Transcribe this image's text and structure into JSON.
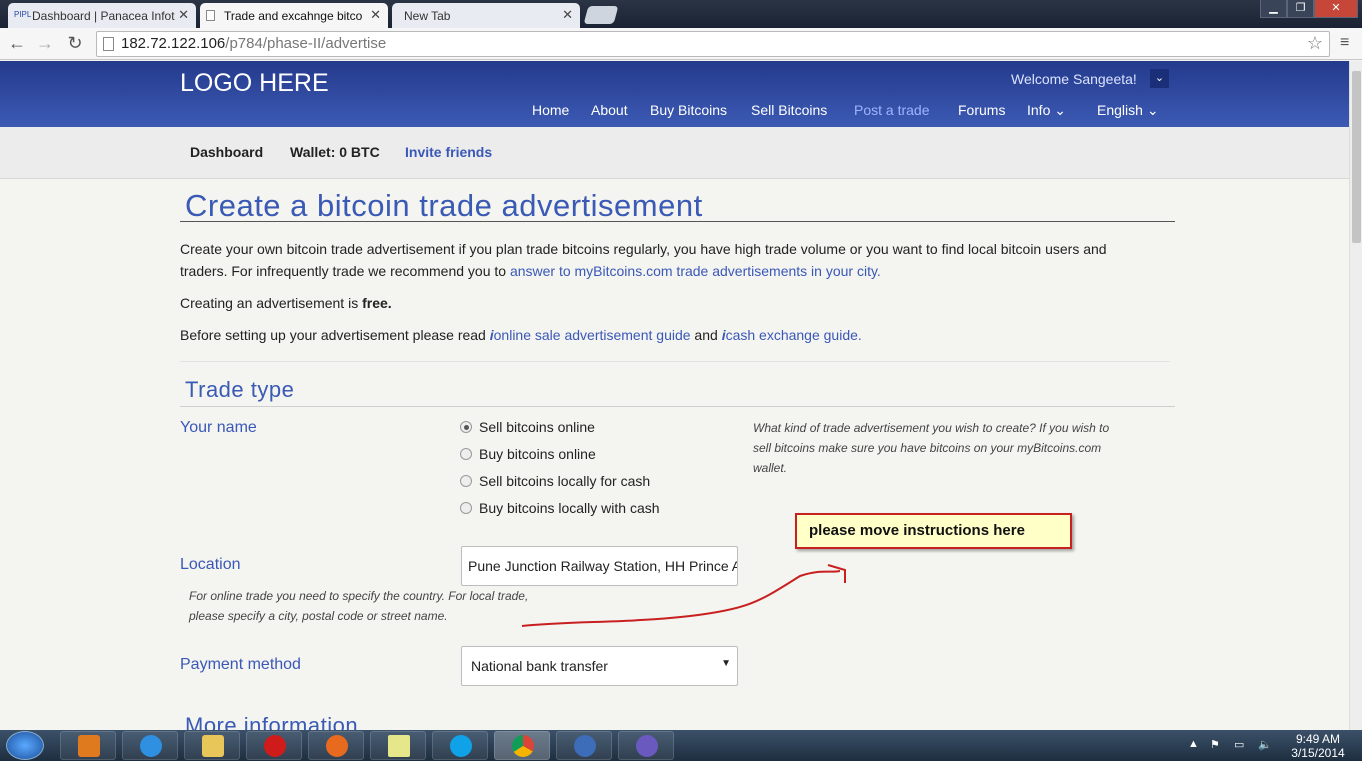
{
  "browser": {
    "tabs": [
      {
        "label": "Dashboard | Panacea Infot",
        "favicon": "PIPL",
        "active": false
      },
      {
        "label": "Trade and excahnge bitco",
        "favicon": "page",
        "active": true
      },
      {
        "label": "New Tab",
        "favicon": "",
        "active": false
      }
    ],
    "address_host": "182.72.122.106",
    "address_path": "/p784/phase-II/advertise"
  },
  "site": {
    "logo": "LOGO HERE",
    "welcome": "Welcome Sangeeta!",
    "nav": [
      "Home",
      "About",
      "Buy Bitcoins",
      "Sell Bitcoins",
      "Post a trade",
      "Forums",
      "Info",
      "English"
    ],
    "subnav": {
      "dashboard": "Dashboard",
      "wallet": "Wallet: 0 BTC",
      "invite": "Invite friends"
    }
  },
  "page": {
    "title": "Create a bitcoin trade advertisement",
    "intro_1": "Create your own bitcoin trade advertisement if you plan trade bitcoins regularly, you have high trade volume or you want to find local bitcoin users and",
    "intro_2_prefix": "traders. For infrequently trade we recommend you to ",
    "intro_2_link": "answer to myBitcoins.com trade advertisements in your city.",
    "free_prefix": "Creating an advertisement is ",
    "free_bold": "free.",
    "guide_prefix": "Before setting up your advertisement please read ",
    "guide_link1": "online sale advertisement guide",
    "guide_and": " and ",
    "guide_link2": "cash exchange guide."
  },
  "trade_type": {
    "heading": "Trade type",
    "your_name_label": "Your name",
    "options": [
      {
        "label": "Sell bitcoins online",
        "selected": true
      },
      {
        "label": "Buy bitcoins online",
        "selected": false
      },
      {
        "label": "Sell bitcoins locally for cash",
        "selected": false
      },
      {
        "label": "Buy bitcoins locally with cash",
        "selected": false
      }
    ],
    "help_1": "What kind of trade advertisement you wish to create? If you wish to",
    "help_2": "sell bitcoins make sure you have bitcoins on your myBitcoins.com",
    "help_3": "wallet.",
    "location_label": "Location",
    "location_value": "Pune Junction Railway Station, HH Prince Aga Khan Rd",
    "location_help_1": "For online trade you need to specify the country. For local trade,",
    "location_help_2": "please specify a city, postal code or street name.",
    "payment_label": "Payment method",
    "payment_value": "National bank transfer",
    "note": "please move instructions here"
  },
  "more_info": {
    "heading": "More information"
  },
  "taskbar": {
    "time": "9:49 AM",
    "date": "3/15/2014"
  },
  "colors": {
    "accent": "#3a58b8",
    "header": "#2c4599",
    "note_border": "#c82020"
  }
}
